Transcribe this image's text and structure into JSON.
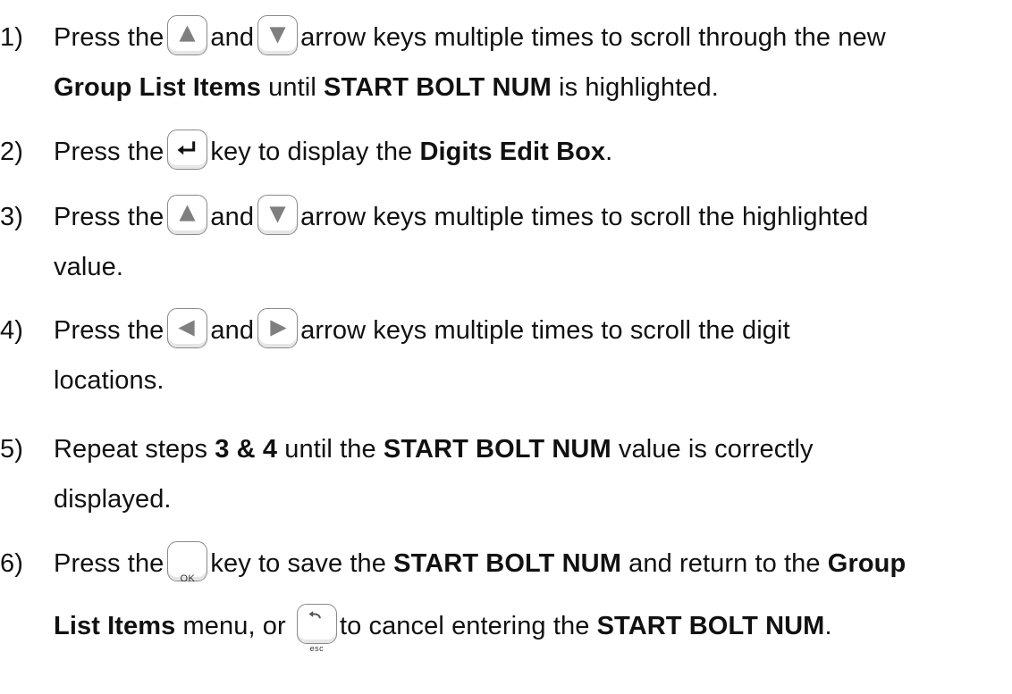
{
  "steps": [
    {
      "number": "1)",
      "line1": {
        "t1": "Press the",
        "t2": "and",
        "t3": "arrow keys multiple times to scroll through the new"
      },
      "line2": {
        "b1": "Group List Items",
        "t1": " until ",
        "b2": "START BOLT NUM",
        "t2": " is highlighted."
      },
      "keys": [
        "up-arrow-icon",
        "down-arrow-icon"
      ]
    },
    {
      "number": "2)",
      "line1": {
        "t1": "Press the",
        "t2": "key to display the ",
        "b1": "Digits Edit Box",
        "t3": "."
      },
      "keys": [
        "enter-icon"
      ]
    },
    {
      "number": "3)",
      "line1": {
        "t1": "Press the",
        "t2": "and",
        "t3": "arrow keys multiple times to scroll the highlighted"
      },
      "line2": {
        "t1": "value."
      },
      "keys": [
        "up-arrow-icon",
        "down-arrow-icon"
      ]
    },
    {
      "number": "4)",
      "line1": {
        "t1": "Press the",
        "t2": "and",
        "t3": "arrow keys multiple times to scroll the digit"
      },
      "line2": {
        "t1": "locations."
      },
      "keys": [
        "left-arrow-icon",
        "right-arrow-icon"
      ]
    },
    {
      "number": "5)",
      "line1": {
        "t1": "Repeat steps ",
        "b1": "3 & 4",
        "t2": " until the ",
        "b2": "START BOLT NUM",
        "t3": " value is correctly"
      },
      "line2": {
        "t1": "displayed."
      }
    },
    {
      "number": "6)",
      "line1": {
        "t1": "Press the",
        "t2": "key to save the ",
        "b1": "START BOLT NUM",
        "t3": " and return to the ",
        "b2": "Group"
      },
      "line2": {
        "b1": "List Items",
        "t1": " menu, or ",
        "t2": "to cancel entering the ",
        "b2": "START BOLT NUM",
        "t3": "."
      },
      "keys": [
        "ok-key-icon",
        "esc-key-icon"
      ],
      "key_labels": {
        "ok": "OK",
        "esc": "esc"
      }
    }
  ],
  "colors": {
    "text": "#111111",
    "key_border": "#8a8a8a",
    "key_glyph": "#7f7f7f"
  }
}
